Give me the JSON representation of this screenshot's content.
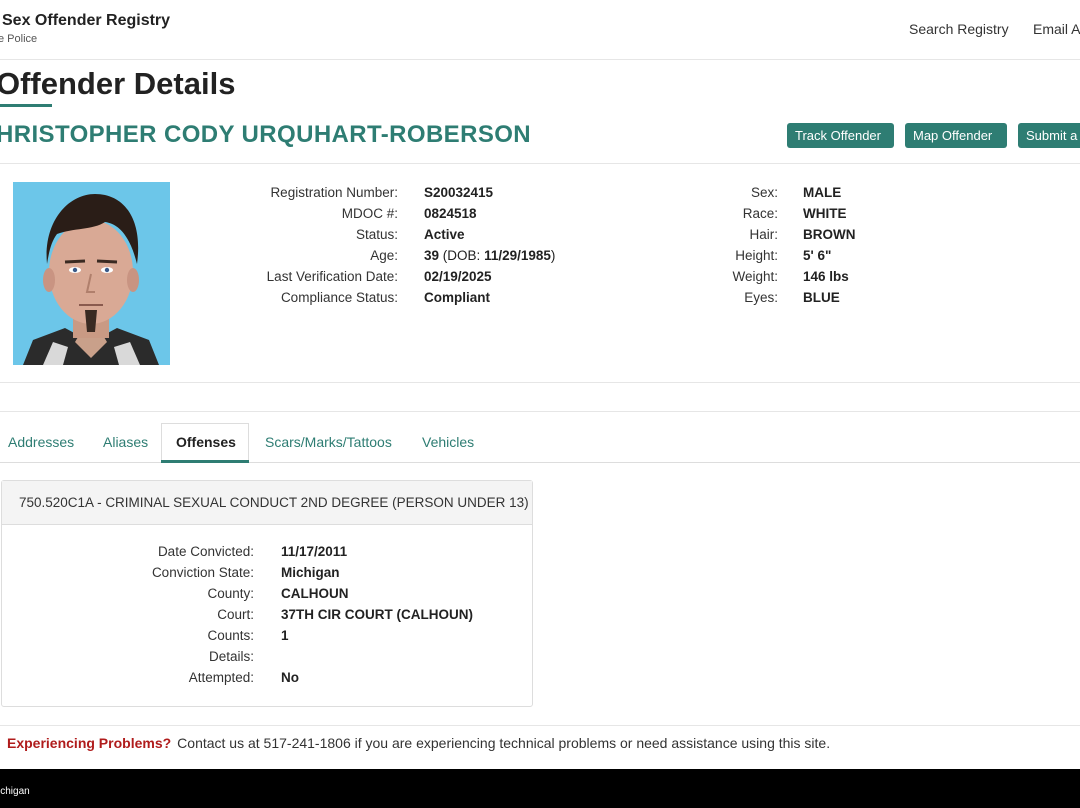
{
  "header": {
    "brand_title": "Sex Offender Registry",
    "brand_subtitle": "e Police",
    "nav": [
      "Search Registry",
      "Email A"
    ]
  },
  "page_title": "Offender Details",
  "offender_name": "HRISTOPHER CODY URQUHART-ROBERSON",
  "buttons": {
    "track": "Track Offender",
    "map": "Map Offender",
    "submit": "Submit a"
  },
  "photo": {
    "description_icon": "offender-photo"
  },
  "details_left": [
    {
      "label": "Registration Number:",
      "value": "S20032415"
    },
    {
      "label": "MDOC #:",
      "value": "0824518"
    },
    {
      "label": "Status:",
      "value": "Active"
    },
    {
      "label": "Age:",
      "value": "39",
      "extra_pre": "(DOB: ",
      "extra_bold": "11/29/1985",
      "extra_post": ")"
    },
    {
      "label": "Last Verification Date:",
      "value": "02/19/2025"
    },
    {
      "label": "Compliance Status:",
      "value": "Compliant"
    }
  ],
  "details_right": [
    {
      "label": "Sex:",
      "value": "MALE"
    },
    {
      "label": "Race:",
      "value": "WHITE"
    },
    {
      "label": "Hair:",
      "value": "BROWN"
    },
    {
      "label": "Height:",
      "value": "5' 6\""
    },
    {
      "label": "Weight:",
      "value": "146 lbs"
    },
    {
      "label": "Eyes:",
      "value": "BLUE"
    }
  ],
  "tabs": [
    "Addresses",
    "Aliases",
    "Offenses",
    "Scars/Marks/Tattoos",
    "Vehicles"
  ],
  "active_tab": "Offenses",
  "offense": {
    "title": "750.520C1A - CRIMINAL SEXUAL CONDUCT 2ND DEGREE (PERSON UNDER 13)",
    "rows": [
      {
        "label": "Date Convicted:",
        "value": "11/17/2011"
      },
      {
        "label": "Conviction State:",
        "value": "Michigan"
      },
      {
        "label": "County:",
        "value": "CALHOUN"
      },
      {
        "label": "Court:",
        "value": "37TH CIR COURT (CALHOUN)"
      },
      {
        "label": "Counts:",
        "value": "1"
      },
      {
        "label": "Details:",
        "value": ""
      },
      {
        "label": "Attempted:",
        "value": "No"
      }
    ]
  },
  "problems": {
    "label": "Experiencing Problems?",
    "text": "Contact us at 517-241-1806 if you are experiencing technical problems or need assistance using this site."
  },
  "footer": {
    "text": "ichigan"
  },
  "colors": {
    "accent": "#2e7d73",
    "warning": "#b01c1c",
    "footer_bg": "#000000"
  }
}
